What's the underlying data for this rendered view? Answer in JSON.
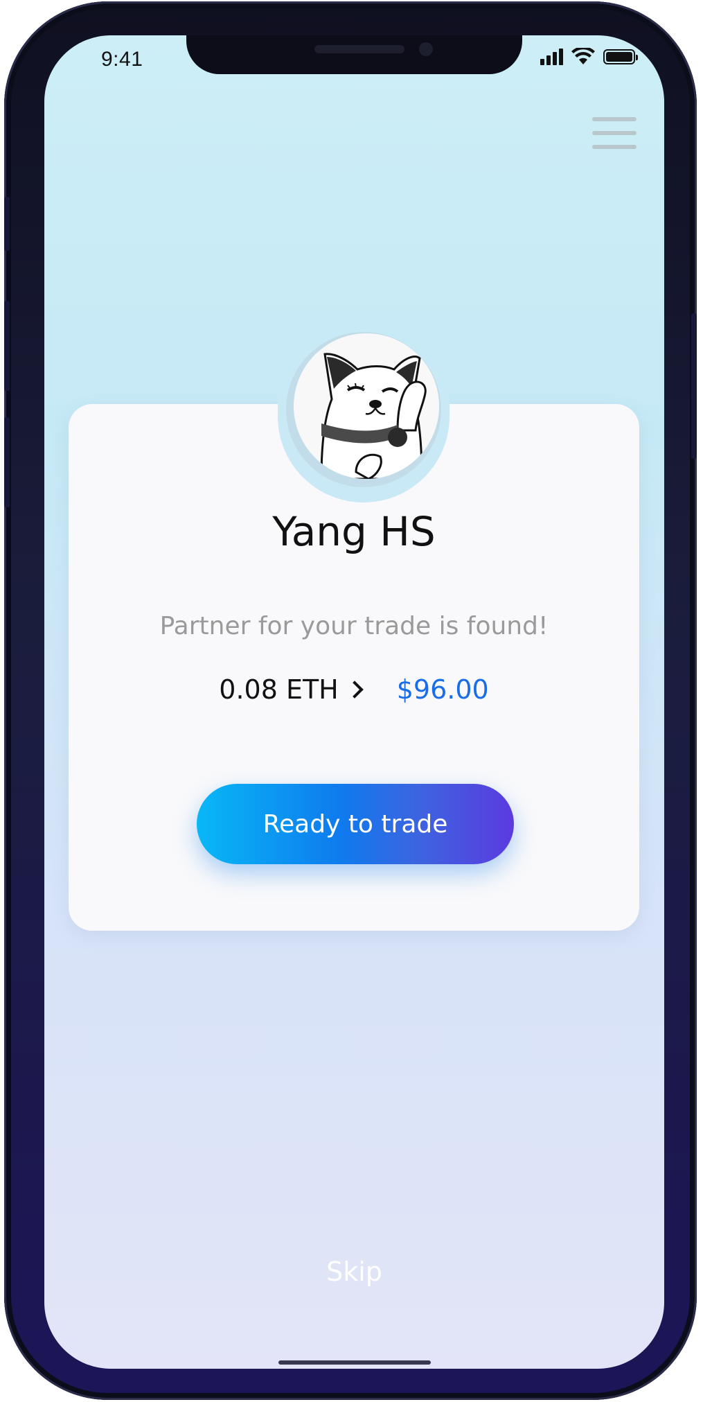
{
  "status_bar": {
    "time": "9:41"
  },
  "profile": {
    "name": "Yang HS",
    "avatar_alt": ""
  },
  "match": {
    "message": "Partner for your trade is found!",
    "crypto_amount": "0.08 ETH",
    "fiat_amount": "$96.00"
  },
  "actions": {
    "primary_label": "Ready to trade",
    "skip_label": "Skip"
  },
  "colors": {
    "accent": "#1a6de8",
    "button_start": "#08b8f6",
    "button_end": "#5b3ae0"
  },
  "icons": [
    "signal-icon",
    "wifi-icon",
    "battery-icon",
    "menu-icon",
    "chevron-right-icon"
  ]
}
